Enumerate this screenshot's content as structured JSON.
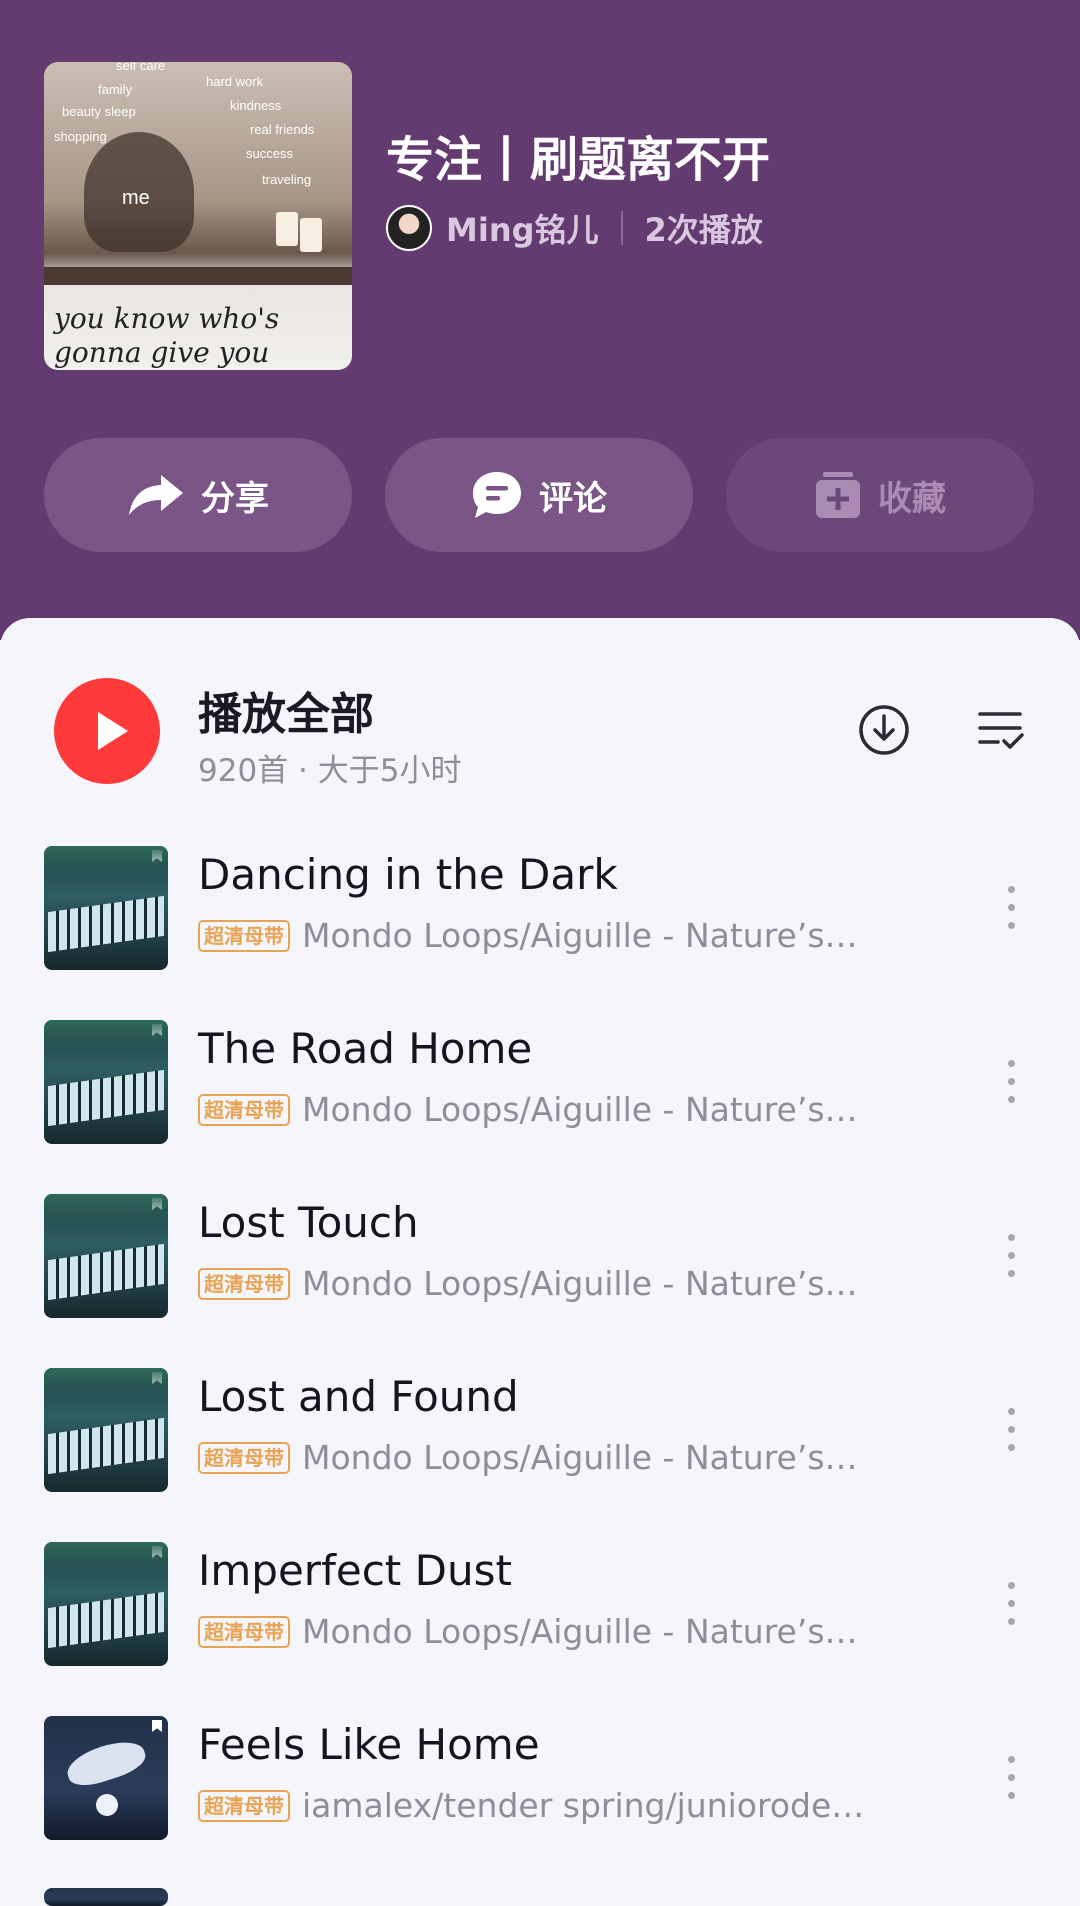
{
  "playlist": {
    "title": "专注丨刷题离不开",
    "creator": "Ming铭儿",
    "plays": "2次播放",
    "cover": {
      "words": [
        "self care",
        "family",
        "beauty sleep",
        "shopping",
        "hard work",
        "kindness",
        "real friends",
        "success",
        "traveling"
      ],
      "me": "me",
      "handwriting_line1": "you know who's",
      "handwriting_line2": "gonna give you"
    }
  },
  "actions": {
    "share": "分享",
    "comment": "评论",
    "collect": "收藏"
  },
  "play_all": {
    "label": "播放全部",
    "summary": "920首 · 大于5小时"
  },
  "colors": {
    "header_bg": "#633b70",
    "accent_red": "#ff3a3a",
    "tag_orange": "#e8a455"
  },
  "songs": [
    {
      "title": "Dancing in the Dark",
      "tag": "超清母带",
      "artist": "Mondo Loops/Aiguille - Nature’s…",
      "art": "piano"
    },
    {
      "title": "The Road Home",
      "tag": "超清母带",
      "artist": "Mondo Loops/Aiguille - Nature’s…",
      "art": "piano"
    },
    {
      "title": "Lost Touch",
      "tag": "超清母带",
      "artist": "Mondo Loops/Aiguille - Nature’s…",
      "art": "piano"
    },
    {
      "title": "Lost and Found",
      "tag": "超清母带",
      "artist": "Mondo Loops/Aiguille - Nature’s…",
      "art": "piano"
    },
    {
      "title": "Imperfect Dust",
      "tag": "超清母带",
      "artist": "Mondo Loops/Aiguille - Nature’s…",
      "art": "piano"
    },
    {
      "title": "Feels Like Home",
      "tag": "超清母带",
      "artist": "iamalex/tender spring/juniorode…",
      "art": "whale"
    }
  ]
}
